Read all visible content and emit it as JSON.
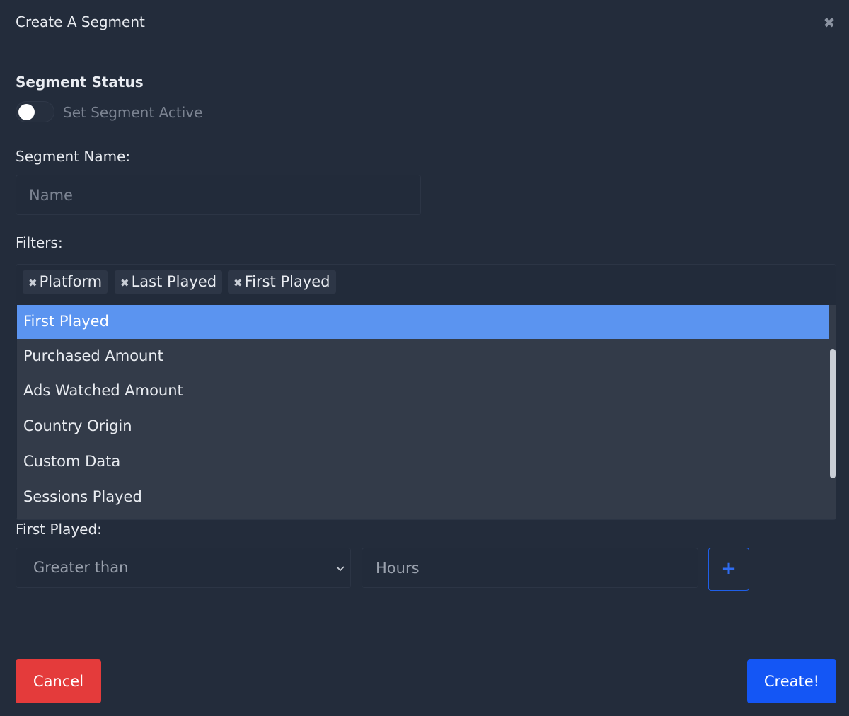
{
  "modal": {
    "title": "Create A Segment",
    "close_icon": "close-icon"
  },
  "status": {
    "label": "Segment Status",
    "toggle_text": "Set Segment Active",
    "active": false
  },
  "name": {
    "label": "Segment Name:",
    "placeholder": "Name",
    "value": ""
  },
  "filters": {
    "label": "Filters:",
    "tags": [
      "Platform",
      "Last Played",
      "First Played"
    ],
    "dropdown_options": [
      "First Played",
      "Purchased Amount",
      "Ads Watched Amount",
      "Country Origin",
      "Custom Data",
      "Sessions Played"
    ],
    "highlighted_option": "First Played"
  },
  "first_played": {
    "label": "First Played:",
    "operator": "Greater than",
    "hours_placeholder": "Hours",
    "add_label": "+"
  },
  "footer": {
    "cancel_label": "Cancel",
    "create_label": "Create!"
  },
  "colors": {
    "background": "#232c3b",
    "highlight": "#5b94f0",
    "cancel": "#e43b3b",
    "create": "#1456f5"
  }
}
